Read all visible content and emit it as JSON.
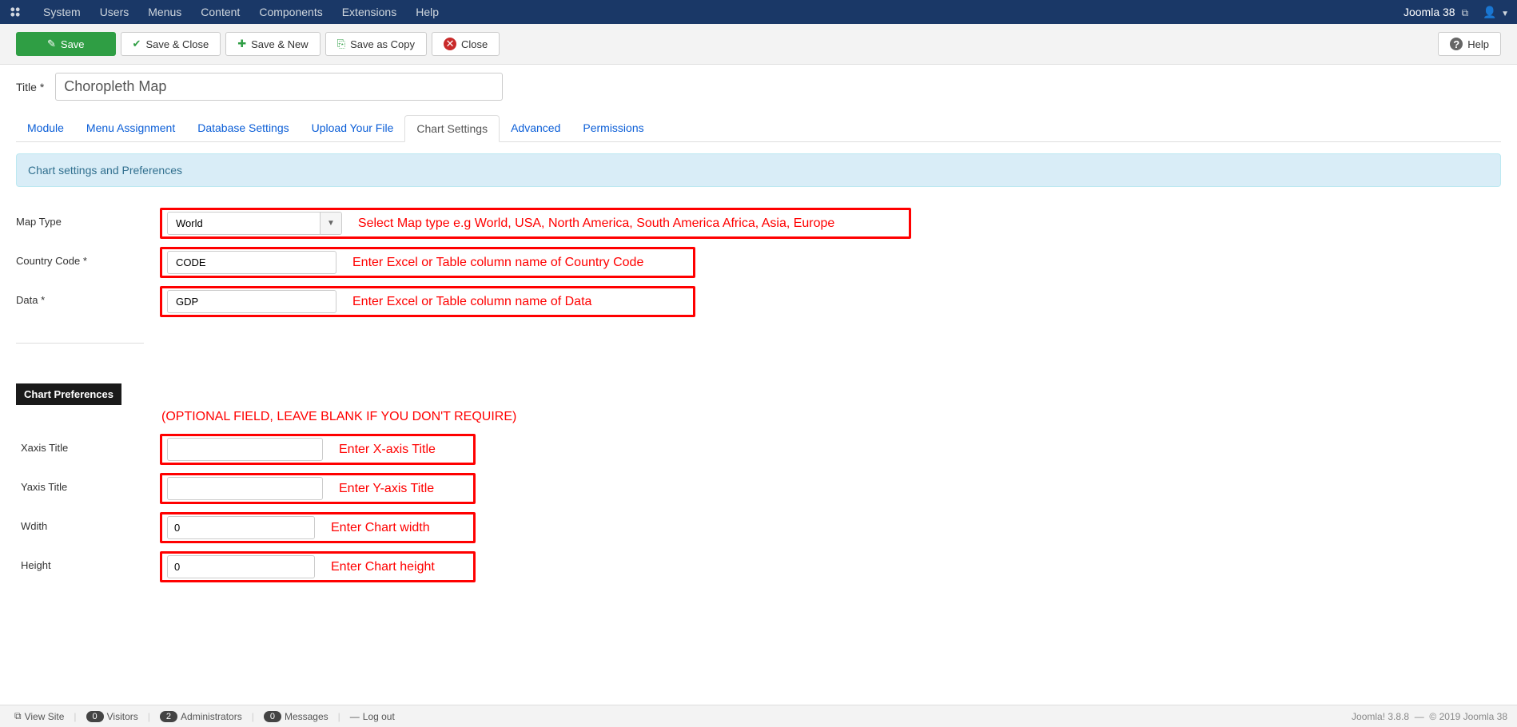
{
  "navbar": {
    "items": [
      "System",
      "Users",
      "Menus",
      "Content",
      "Components",
      "Extensions",
      "Help"
    ],
    "site_name": "Joomla 38"
  },
  "toolbar": {
    "save": "Save",
    "save_close": "Save & Close",
    "save_new": "Save & New",
    "save_copy": "Save as Copy",
    "close": "Close",
    "help": "Help"
  },
  "title": {
    "label": "Title *",
    "value": "Choropleth Map"
  },
  "tabs": [
    "Module",
    "Menu Assignment",
    "Database Settings",
    "Upload Your File",
    "Chart Settings",
    "Advanced",
    "Permissions"
  ],
  "active_tab": "Chart Settings",
  "alert": "Chart settings and Preferences",
  "form": {
    "map_type": {
      "label": "Map Type",
      "value": "World",
      "annot": "Select Map type e.g World, USA, North America, South America Africa, Asia, Europe"
    },
    "country_code": {
      "label": "Country Code *",
      "value": "CODE",
      "annot": "Enter Excel or Table column name of Country Code"
    },
    "data": {
      "label": "Data *",
      "value": "GDP",
      "annot": "Enter Excel or Table column name of Data"
    }
  },
  "section_badge": "Chart Preferences",
  "optional_note": "(OPTIONAL FIELD, LEAVE BLANK IF YOU DON'T REQUIRE)",
  "prefs": {
    "xaxis": {
      "label": "Xaxis Title",
      "value": "",
      "annot": "Enter X-axis Title"
    },
    "yaxis": {
      "label": "Yaxis Title",
      "value": "",
      "annot": "Enter Y-axis Title"
    },
    "width": {
      "label": "Wdith",
      "value": "0",
      "annot": "Enter Chart width"
    },
    "height": {
      "label": "Height",
      "value": "0",
      "annot": "Enter Chart height"
    }
  },
  "footer": {
    "view_site": "View Site",
    "visitors": {
      "count": "0",
      "label": "Visitors"
    },
    "admins": {
      "count": "2",
      "label": "Administrators"
    },
    "messages": {
      "count": "0",
      "label": "Messages"
    },
    "logout": "Log out",
    "version": "Joomla! 3.8.8",
    "copyright": "© 2019 Joomla 38"
  }
}
